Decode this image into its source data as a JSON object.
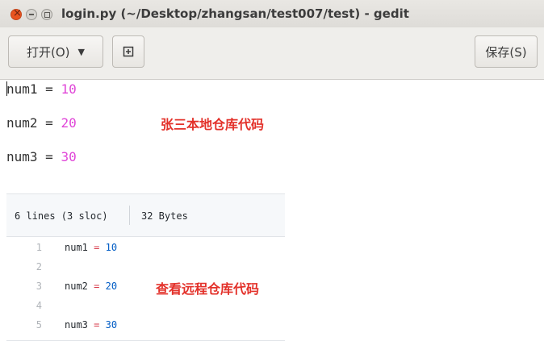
{
  "window": {
    "title": "login.py (~/Desktop/zhangsan/test007/test) - gedit"
  },
  "toolbar": {
    "open_label": "打开(O)",
    "save_label": "保存(S)"
  },
  "editor": {
    "lines": [
      {
        "var": "num1",
        "op": "=",
        "val": "10"
      },
      {
        "var": "num2",
        "op": "=",
        "val": "20"
      },
      {
        "var": "num3",
        "op": "=",
        "val": "30"
      }
    ],
    "annotation": "张三本地仓库代码"
  },
  "remote": {
    "lines_info": "6 lines (3 sloc)",
    "size_info": "32 Bytes",
    "rows": [
      {
        "n": "1",
        "var": "num1",
        "op": "=",
        "val": "10"
      },
      {
        "n": "2",
        "var": "",
        "op": "",
        "val": ""
      },
      {
        "n": "3",
        "var": "num2",
        "op": "=",
        "val": "20"
      },
      {
        "n": "4",
        "var": "",
        "op": "",
        "val": ""
      },
      {
        "n": "5",
        "var": "num3",
        "op": "=",
        "val": "30"
      }
    ],
    "annotation": "查看远程仓库代码"
  },
  "colors": {
    "close_button": "#e95420",
    "number_literal": "#e046d8",
    "annotation": "#e3312a",
    "remote_number": "#005cc5",
    "remote_operator": "#d73a49"
  }
}
